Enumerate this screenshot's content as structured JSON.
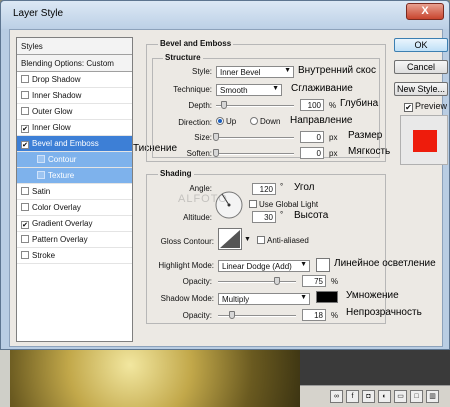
{
  "window": {
    "title": "Layer Style",
    "close": "X"
  },
  "styles_list": {
    "header": "Styles",
    "blending": "Blending Options: Custom",
    "items": [
      {
        "label": "Drop Shadow",
        "checked": false,
        "type": "normal"
      },
      {
        "label": "Inner Shadow",
        "checked": false,
        "type": "normal"
      },
      {
        "label": "Outer Glow",
        "checked": false,
        "type": "normal"
      },
      {
        "label": "Inner Glow",
        "checked": true,
        "type": "normal"
      },
      {
        "label": "Bevel and Emboss",
        "checked": true,
        "type": "selected"
      },
      {
        "label": "Contour",
        "checked": false,
        "type": "sub"
      },
      {
        "label": "Texture",
        "checked": false,
        "type": "sub"
      },
      {
        "label": "Satin",
        "checked": false,
        "type": "normal"
      },
      {
        "label": "Color Overlay",
        "checked": false,
        "type": "normal"
      },
      {
        "label": "Gradient Overlay",
        "checked": true,
        "type": "normal"
      },
      {
        "label": "Pattern Overlay",
        "checked": false,
        "type": "normal"
      },
      {
        "label": "Stroke",
        "checked": false,
        "type": "normal"
      }
    ],
    "annotation": "Тиснение"
  },
  "buttons": {
    "ok": "OK",
    "cancel": "Cancel",
    "new_style": "New Style...",
    "preview": "Preview",
    "preview_checked": "✔"
  },
  "bevel": {
    "title": "Bevel and Emboss",
    "structure_title": "Structure",
    "style_label": "Style:",
    "style_value": "Inner Bevel",
    "style_ru": "Внутренний скос",
    "technique_label": "Technique:",
    "technique_value": "Smooth",
    "technique_ru": "Сглаживание",
    "depth_label": "Depth:",
    "depth_value": "100",
    "depth_unit": "%",
    "depth_ru": "Глубина",
    "depth_level": 0.1,
    "direction_label": "Direction:",
    "direction_up": "Up",
    "direction_down": "Down",
    "direction_ru": "Направление",
    "size_label": "Size:",
    "size_value": "0",
    "size_unit": "px",
    "size_ru": "Размер",
    "soften_label": "Soften:",
    "soften_value": "0",
    "soften_unit": "px",
    "soften_ru": "Мягкость"
  },
  "shading": {
    "title": "Shading",
    "angle_label": "Angle:",
    "angle_value": "120",
    "angle_unit": "°",
    "angle_ru": "Угол",
    "global_light": "Use Global Light",
    "altitude_label": "Altitude:",
    "altitude_value": "30",
    "altitude_unit": "°",
    "altitude_ru": "Высота",
    "gloss_label": "Gloss Contour:",
    "anti_aliased": "Anti-aliased",
    "highlight_label": "Highlight Mode:",
    "highlight_value": "Linear Dodge (Add)",
    "highlight_ru": "Линейное осветление",
    "highlight_opacity_label": "Opacity:",
    "highlight_opacity_value": "75",
    "highlight_opacity_unit": "%",
    "highlight_opacity_level": 0.75,
    "shadow_label": "Shadow Mode:",
    "shadow_value": "Multiply",
    "shadow_ru": "Умножение",
    "shadow_opacity_label": "Opacity:",
    "shadow_opacity_value": "18",
    "shadow_opacity_unit": "%",
    "shadow_opacity_ru": "Непрозрачность",
    "shadow_opacity_level": 0.18
  },
  "watermark": "ALFOTO"
}
